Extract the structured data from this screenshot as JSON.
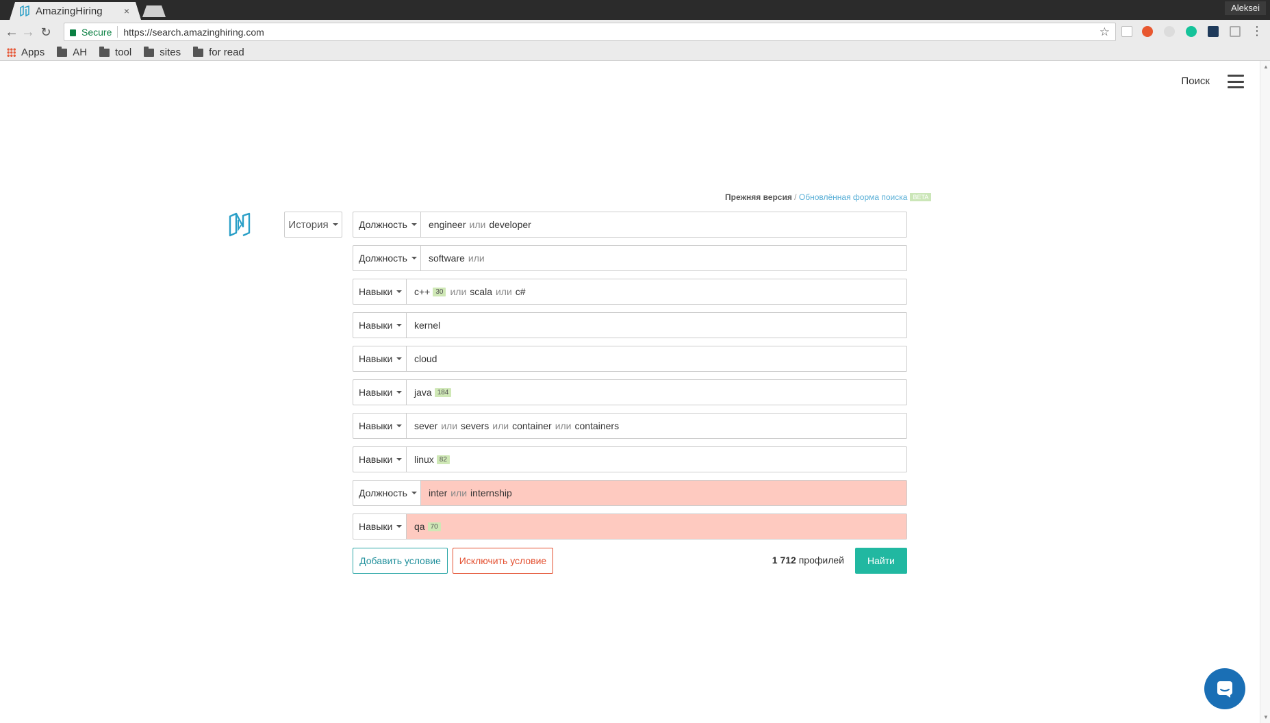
{
  "browser": {
    "tab_title": "AmazingHiring",
    "tab_close": "×",
    "user_name": "Aleksei",
    "secure_label": "Secure",
    "url": "https://search.amazinghiring.com",
    "bookmarks": [
      {
        "label": "Apps",
        "icon": "apps-grid-icon"
      },
      {
        "label": "AH",
        "icon": "folder-icon"
      },
      {
        "label": "tool",
        "icon": "folder-icon"
      },
      {
        "label": "sites",
        "icon": "folder-icon"
      },
      {
        "label": "for read",
        "icon": "folder-icon"
      }
    ]
  },
  "header": {
    "search_link": "Поиск",
    "menu_icon": "hamburger-icon"
  },
  "version": {
    "old": "Прежняя версия",
    "separator": " / ",
    "new": "Обновлённая форма поиска",
    "beta": "BETA"
  },
  "history_label": "История",
  "conditions": [
    {
      "type": "Должность",
      "excluded": false,
      "terms": [
        "engineer",
        "или",
        "developer"
      ],
      "count": ""
    },
    {
      "type": "Должность",
      "excluded": false,
      "terms": [
        "software",
        "или"
      ],
      "count": ""
    },
    {
      "type": "Навыки",
      "excluded": false,
      "terms": [
        "c++"
      ],
      "count": "30",
      "after": [
        "или",
        "scala",
        "или",
        "c#"
      ]
    },
    {
      "type": "Навыки",
      "excluded": false,
      "terms": [
        "kernel"
      ],
      "count": ""
    },
    {
      "type": "Навыки",
      "excluded": false,
      "terms": [
        "cloud"
      ],
      "count": ""
    },
    {
      "type": "Навыки",
      "excluded": false,
      "terms": [
        "java"
      ],
      "count": "184"
    },
    {
      "type": "Навыки",
      "excluded": false,
      "terms": [
        "sever",
        "или",
        "severs",
        "или",
        "container",
        "или",
        "containers"
      ],
      "count": ""
    },
    {
      "type": "Навыки",
      "excluded": false,
      "terms": [
        "linux"
      ],
      "count": "82"
    },
    {
      "type": "Должность",
      "excluded": true,
      "terms": [
        "inter",
        "или",
        "internship"
      ],
      "count": ""
    },
    {
      "type": "Навыки",
      "excluded": true,
      "terms": [
        "qa"
      ],
      "count": "70"
    }
  ],
  "actions": {
    "add_label": "Добавить условие",
    "exclude_label": "Исключить условие",
    "profiles_count": "1 712",
    "profiles_word": "профилей",
    "find_label": "Найти"
  },
  "colors": {
    "accent_teal": "#21b8a1",
    "exclude_red": "#e34f2f",
    "excluded_bg": "#fecac0",
    "count_badge": "#cfe8b6",
    "chat_blue": "#1a6fb5"
  }
}
